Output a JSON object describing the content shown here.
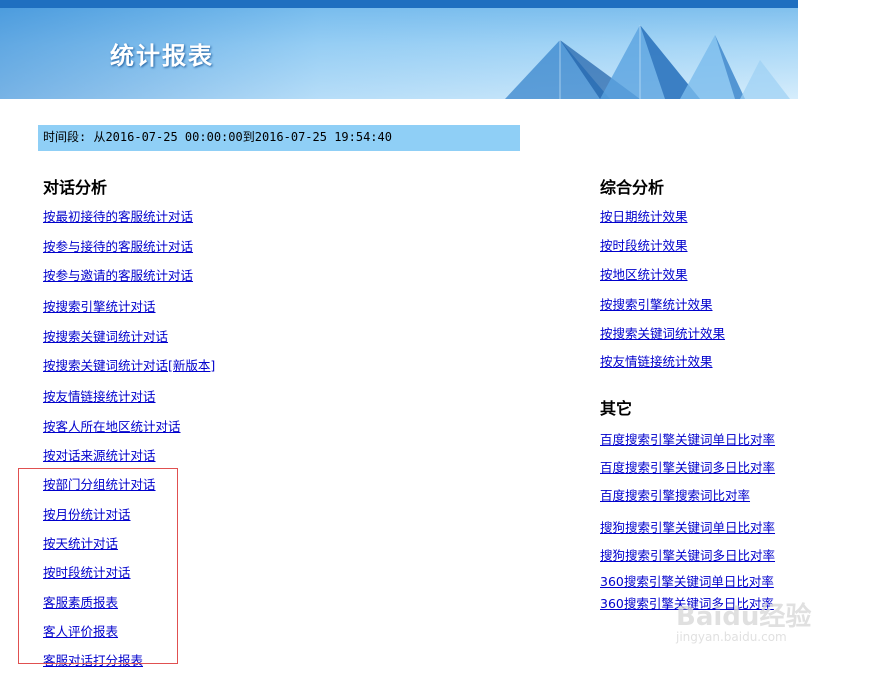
{
  "header": {
    "title": "统计报表"
  },
  "timerange": {
    "text": "时间段: 从2016-07-25 00:00:00到2016-07-25 19:54:40"
  },
  "dialog_analysis": {
    "heading": "对话分析",
    "links": [
      "按最初接待的客服统计对话",
      "按参与接待的客服统计对话",
      "按参与邀请的客服统计对话",
      "按搜索引擎统计对话",
      "按搜索关键词统计对话",
      "按搜索关键词统计对话[新版本]",
      "按友情链接统计对话",
      "按客人所在地区统计对话",
      "按对话来源统计对话",
      "按部门分组统计对话",
      "按月份统计对话",
      "按天统计对话",
      "按时段统计对话",
      "客服素质报表",
      "客人评价报表",
      "客服对话打分报表"
    ]
  },
  "comprehensive": {
    "heading": "综合分析",
    "links": [
      "按日期统计效果",
      "按时段统计效果",
      "按地区统计效果",
      "按搜索引擎统计效果",
      "按搜索关键词统计效果",
      "按友情链接统计效果"
    ]
  },
  "other": {
    "heading": "其它",
    "links": [
      "百度搜索引擎关键词单日比对率",
      "百度搜索引擎关键词多日比对率",
      "百度搜索引擎搜索词比对率",
      "搜狗搜索引擎关键词单日比对率",
      "搜狗搜索引擎关键词多日比对率",
      "360搜索引擎关键词单日比对率",
      "360搜索引擎关键词多日比对率"
    ]
  },
  "watermark": {
    "main": "Baidu经验",
    "sub": "jingyan.baidu.com"
  },
  "colors": {
    "link": "#0000cc",
    "timebar": "#8fcff6",
    "highlight_box": "#e05050"
  }
}
